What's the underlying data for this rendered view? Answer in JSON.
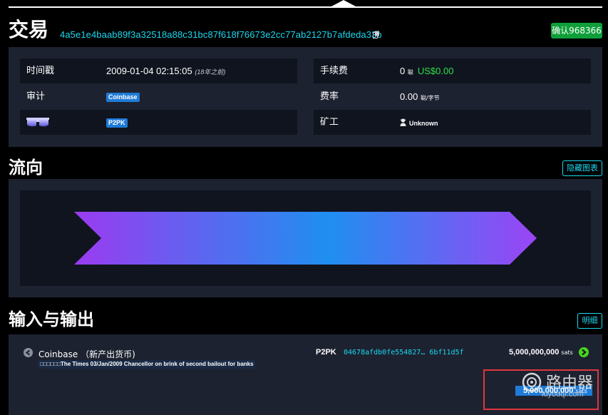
{
  "header": {
    "title": "交易",
    "txid": "4a5e1e4baab89f3a32518a88c31bc87f618f76673e2cc77ab2127b7afdeda33b",
    "confirmations": "确认968366"
  },
  "info": {
    "timestamp_label": "时间戳",
    "timestamp_value": "2009-01-04 02:15:05",
    "timestamp_ago": "(18年之前)",
    "audit_label": "审计",
    "audit_tag": "Coinbase",
    "script_tag": "P2PK",
    "fee_label": "手续费",
    "fee_value": "0",
    "fee_unit": "聪",
    "fee_usd": "US$0.00",
    "rate_label": "费率",
    "rate_value": "0.00",
    "rate_unit": "聪/字节",
    "miner_label": "矿工",
    "miner_value": "Unknown"
  },
  "flow": {
    "title": "流向",
    "hide_chart": "隐藏图表"
  },
  "io": {
    "title": "输入与输出",
    "details": "明细",
    "input_label": "Coinbase （新产出货币)",
    "coinbase_message": "□□□□□□The Times 03/Jan/2009 Chancellor on brink of second bailout for banks",
    "script_type": "P2PK",
    "address": "04678afdb0fe554827… 6bf11d5f",
    "amount": "5,000,000,000",
    "amount_unit": "sats",
    "total": "5,000,000,000",
    "total_unit": "sats"
  },
  "watermark": {
    "text": "路由器",
    "url": "luyouqi.com"
  },
  "colors": {
    "accent": "#1bd8f0",
    "confirm": "#0f9f3a",
    "tag": "#1f7bd6",
    "fee_usd": "#2ee04a",
    "flow_start": "#9b3bf0",
    "flow_mid": "#1f8ff0",
    "flow_end": "#9a45f5"
  }
}
